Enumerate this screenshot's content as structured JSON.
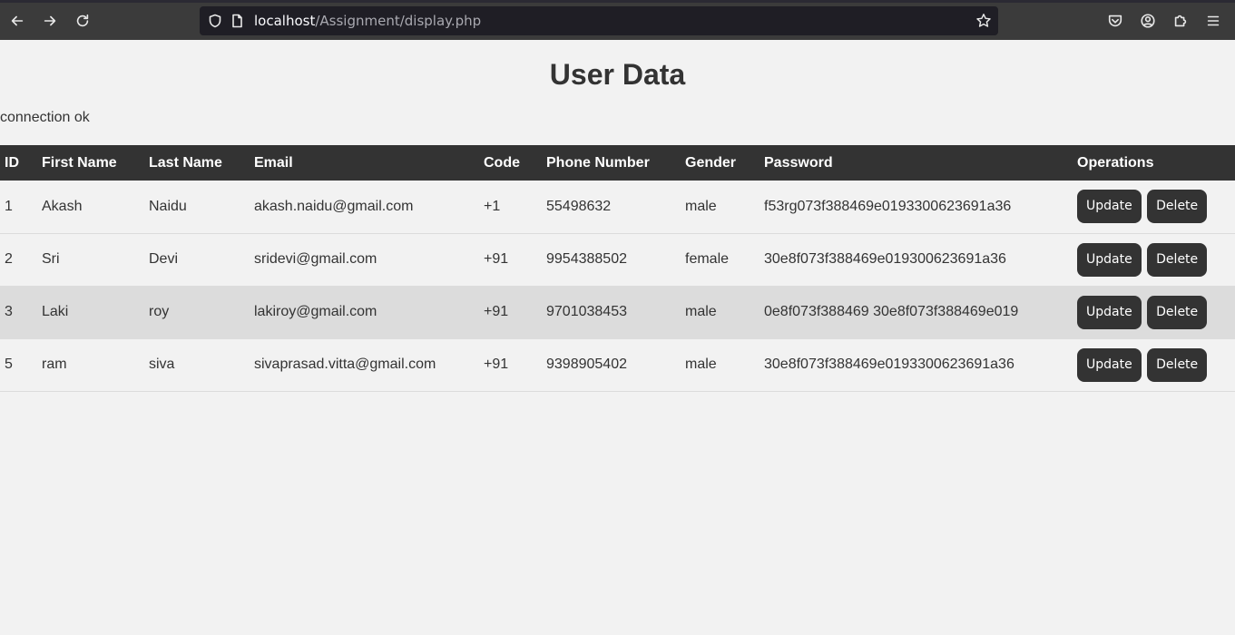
{
  "browser": {
    "url_host": "localhost",
    "url_path": "/Assignment/display.php"
  },
  "page": {
    "title": "User Data",
    "status": "connection ok"
  },
  "table": {
    "headers": [
      "ID",
      "First Name",
      "Last Name",
      "Email",
      "Code",
      "Phone Number",
      "Gender",
      "Password",
      "Operations"
    ],
    "rows": [
      {
        "id": "1",
        "first": "Akash",
        "last": "Naidu",
        "email": "akash.naidu@gmail.com",
        "code": "+1",
        "phone": "55498632",
        "gender": "male",
        "password": "f53rg073f388469e0193300623691a36"
      },
      {
        "id": "2",
        "first": "Sri",
        "last": "Devi",
        "email": "sridevi@gmail.com",
        "code": "+91",
        "phone": "9954388502",
        "gender": "female",
        "password": "30e8f073f388469e019300623691a36"
      },
      {
        "id": "3",
        "first": "Laki",
        "last": "roy",
        "email": "lakiroy@gmail.com",
        "code": "+91",
        "phone": "9701038453",
        "gender": "male",
        "password": "0e8f073f388469 30e8f073f388469e019"
      },
      {
        "id": "5",
        "first": "ram",
        "last": "siva",
        "email": "sivaprasad.vitta@gmail.com",
        "code": "+91",
        "phone": "9398905402",
        "gender": "male",
        "password": "30e8f073f388469e0193300623691a36"
      }
    ],
    "update_label": "Update",
    "delete_label": "Delete"
  }
}
